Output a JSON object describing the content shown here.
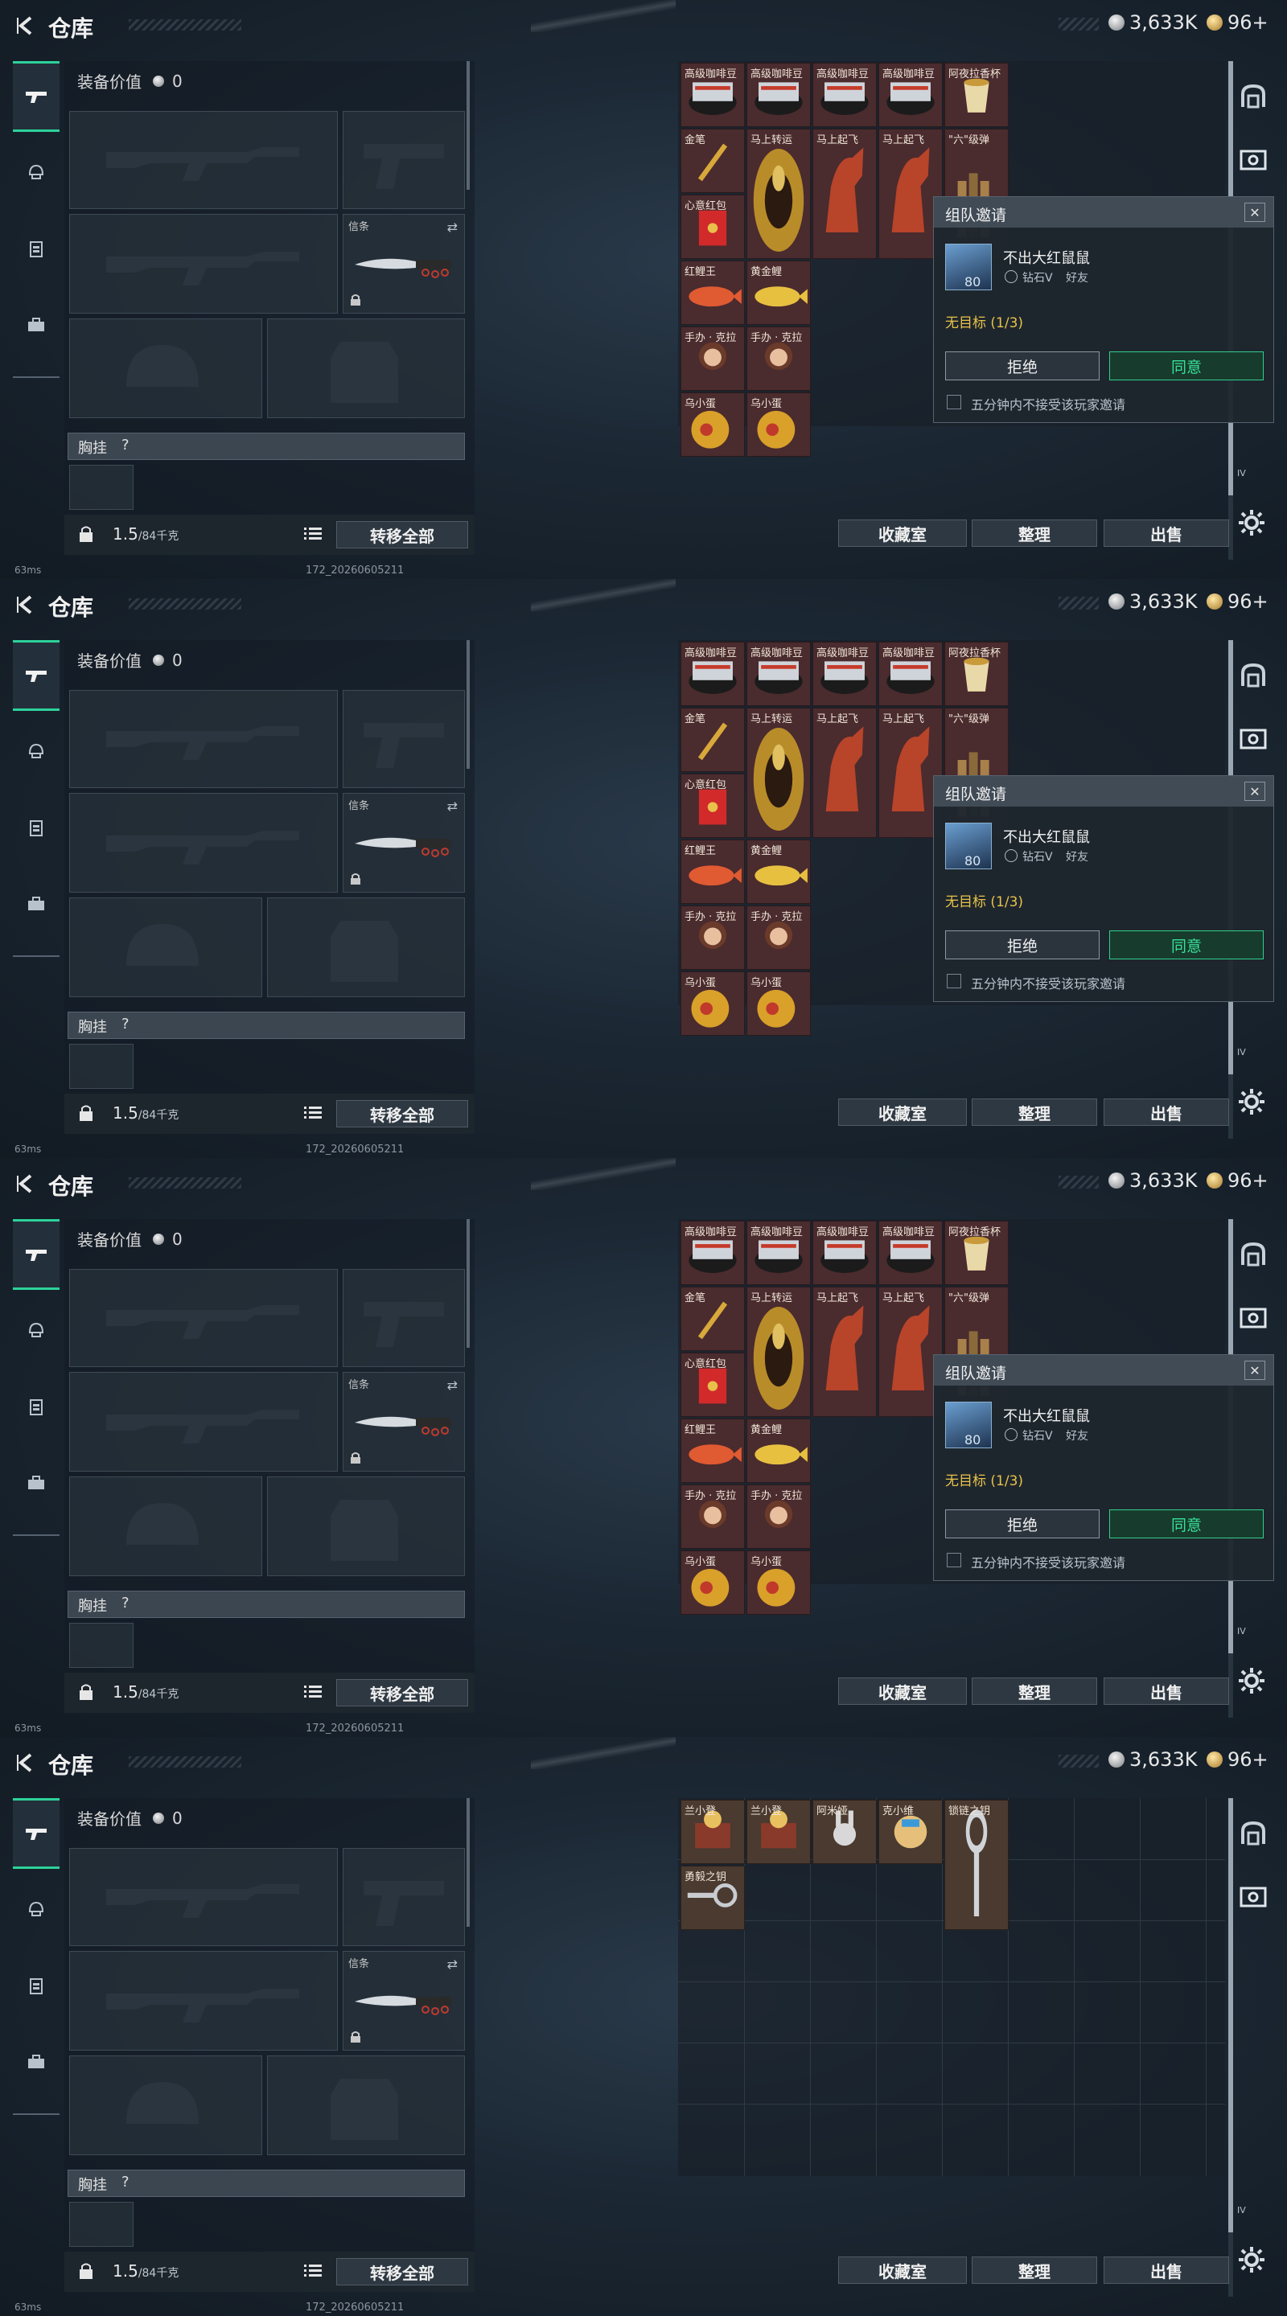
{
  "header": {
    "title": "仓库",
    "currency_silver": "3,633K",
    "currency_gold": "96+"
  },
  "equipment": {
    "value_label": "装备价值",
    "value": "0",
    "melee_slot_label": "信条",
    "chest_label": "胸挂",
    "chest_help": "?",
    "weight_value": "1.5",
    "weight_cap": "/84千克",
    "transfer_all": "转移全部"
  },
  "status": {
    "ping": "63ms",
    "version": "172_20260605211"
  },
  "stash_buttons": {
    "collection": "收藏室",
    "sort": "整理",
    "sell": "出售"
  },
  "stash_items": [
    {
      "label": "高级咖啡豆"
    },
    {
      "label": "高级咖啡豆"
    },
    {
      "label": "高级咖啡豆"
    },
    {
      "label": "高级咖啡豆"
    },
    {
      "label": "阿夜拉香杯"
    },
    {
      "label": "金笔"
    },
    {
      "label": "马上转运"
    },
    {
      "label": "马上起飞"
    },
    {
      "label": "马上起飞"
    },
    {
      "label": "\"六\"级弹"
    },
    {
      "label": "心意红包"
    },
    {
      "label": "红鲤王"
    },
    {
      "label": "黄金鲤"
    },
    {
      "label": "手办 · 克拉"
    },
    {
      "label": "手办 · 克拉"
    },
    {
      "label": "乌小蛋"
    },
    {
      "label": "乌小蛋"
    }
  ],
  "stash_items_2": [
    {
      "label": "兰小登"
    },
    {
      "label": "兰小登"
    },
    {
      "label": "阿米娅"
    },
    {
      "label": "克小维"
    },
    {
      "label": "锁链之钥"
    },
    {
      "label": "勇毅之钥"
    }
  ],
  "invite": {
    "title": "组队邀请",
    "close": "✕",
    "player_name": "不出大红鼠鼠",
    "player_level": "80",
    "rank": "钻石V",
    "relation": "好友",
    "target": "无目标 (1/3)",
    "reject": "拒绝",
    "accept": "同意",
    "mute_label": "五分钟内不接受该玩家邀请"
  },
  "right_column": {
    "tag": "IV"
  },
  "colors": {
    "accent": "#2dd29a",
    "accept": "#38e09a",
    "target": "#e8c24a",
    "item_bg": "#4a2b2e"
  },
  "icons": [
    "back-icon",
    "silver-coin-icon",
    "gold-coin-icon",
    "gun-icon",
    "helmet-icon",
    "vest-icon",
    "backpack-icon",
    "lock-icon",
    "list-icon",
    "swap-icon",
    "gear-icon",
    "close-icon"
  ]
}
